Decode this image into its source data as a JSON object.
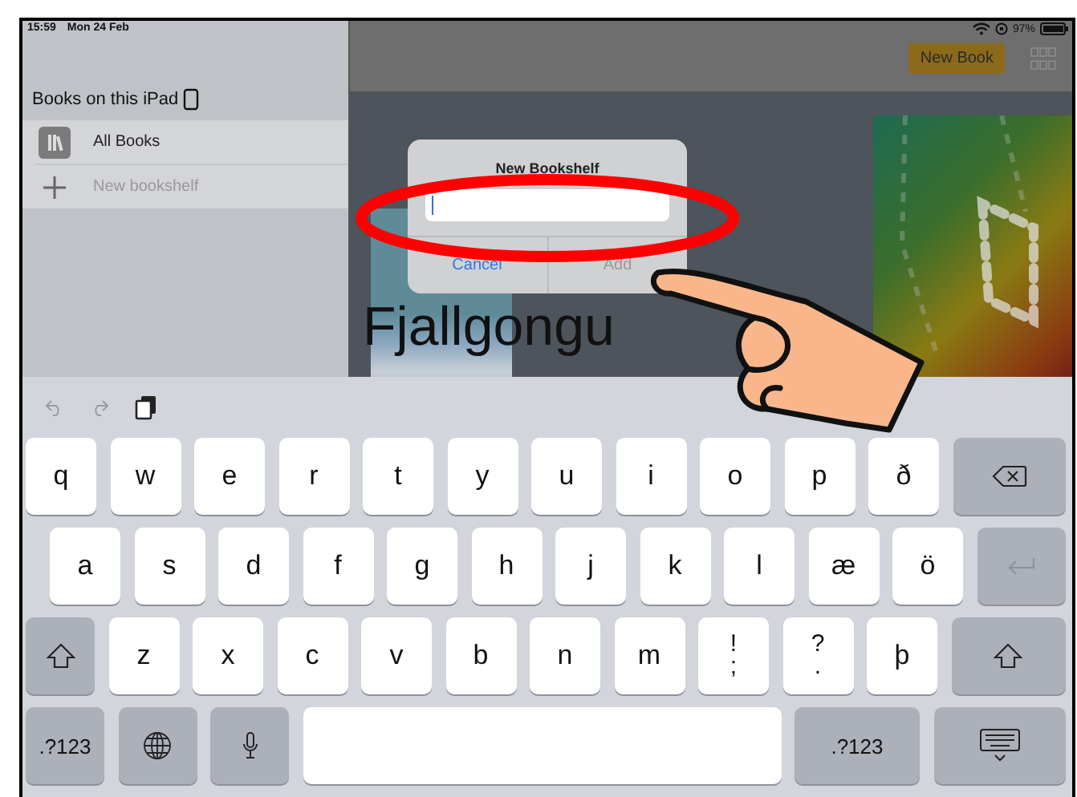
{
  "status_bar": {
    "time": "15:59",
    "date": "Mon 24 Feb",
    "battery": "97%"
  },
  "sidebar": {
    "title": "Books on this iPad",
    "items": [
      {
        "kind": "collection",
        "label": "All Books"
      },
      {
        "kind": "add",
        "label": "New bookshelf"
      }
    ]
  },
  "toolbar": {
    "button": "New Book"
  },
  "book_title": "Fjallgongu",
  "dialog": {
    "title": "New Bookshelf",
    "buttons": [
      {
        "label": "Cancel",
        "disabled": false
      },
      {
        "label": "Add",
        "disabled": true
      }
    ]
  },
  "keyboard": {
    "rows": [
      [
        {
          "kind": "char",
          "label": "q"
        },
        {
          "kind": "char",
          "label": "w"
        },
        {
          "kind": "char",
          "label": "e"
        },
        {
          "kind": "char",
          "label": "r"
        },
        {
          "kind": "char",
          "label": "t"
        },
        {
          "kind": "char",
          "label": "y"
        },
        {
          "kind": "char",
          "label": "u"
        },
        {
          "kind": "char",
          "label": "i"
        },
        {
          "kind": "char",
          "label": "o"
        },
        {
          "kind": "char",
          "label": "p"
        },
        {
          "kind": "char",
          "label": "ð"
        },
        {
          "kind": "delete"
        }
      ],
      [
        {
          "kind": "char",
          "label": "a"
        },
        {
          "kind": "char",
          "label": "s"
        },
        {
          "kind": "char",
          "label": "d"
        },
        {
          "kind": "char",
          "label": "f"
        },
        {
          "kind": "char",
          "label": "g"
        },
        {
          "kind": "char",
          "label": "h"
        },
        {
          "kind": "char",
          "label": "j"
        },
        {
          "kind": "char",
          "label": "k"
        },
        {
          "kind": "char",
          "label": "l"
        },
        {
          "kind": "char",
          "label": "æ"
        },
        {
          "kind": "char",
          "label": "ö"
        },
        {
          "kind": "return"
        }
      ],
      [
        {
          "kind": "shift"
        },
        {
          "kind": "char",
          "label": "z"
        },
        {
          "kind": "char",
          "label": "x"
        },
        {
          "kind": "char",
          "label": "c"
        },
        {
          "kind": "char",
          "label": "v"
        },
        {
          "kind": "char",
          "label": "b"
        },
        {
          "kind": "char",
          "label": "n"
        },
        {
          "kind": "char",
          "label": "m"
        },
        {
          "kind": "char",
          "label": "!",
          "label2": ";"
        },
        {
          "kind": "char",
          "label": "?",
          "label2": "."
        },
        {
          "kind": "char",
          "label": "þ"
        },
        {
          "kind": "shift"
        }
      ],
      [
        {
          "kind": "mode",
          "label": ".?123"
        },
        {
          "kind": "globe"
        },
        {
          "kind": "mic"
        },
        {
          "kind": "space"
        },
        {
          "kind": "mode",
          "label": ".?123"
        },
        {
          "kind": "hide"
        }
      ]
    ]
  }
}
